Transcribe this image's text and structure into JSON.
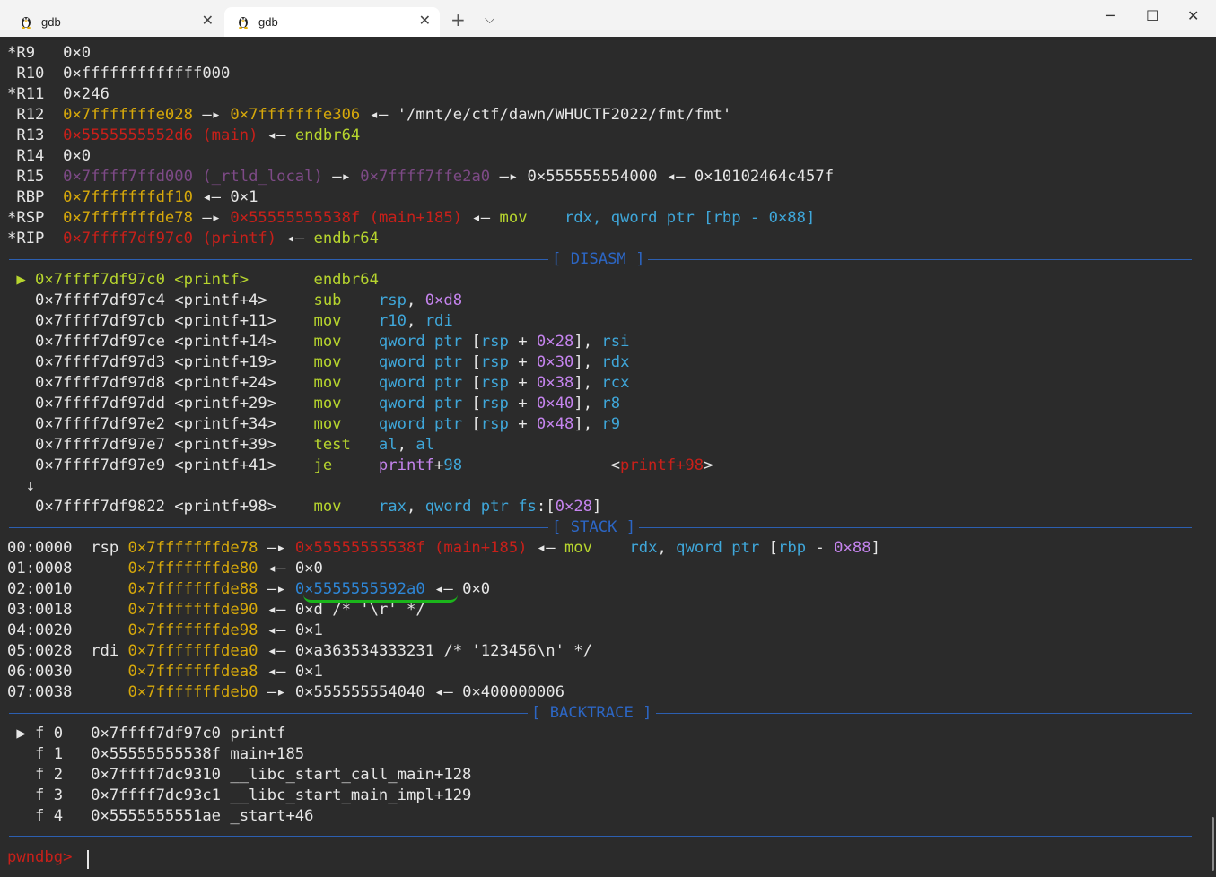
{
  "tabs": [
    {
      "label": "gdb"
    },
    {
      "label": "gdb"
    }
  ],
  "window": {
    "new_tab": "+",
    "dropdown": "⌵",
    "minimize": "─",
    "maximize": "☐",
    "close": "✕",
    "tab_close": "✕"
  },
  "registers": {
    "r9": {
      "name": "*R9",
      "val": "0×0"
    },
    "r10": {
      "name": " R10",
      "val": "0×fffffffffffff000"
    },
    "r11": {
      "name": "*R11",
      "val": "0×246"
    },
    "r12": {
      "name": " R12",
      "a1": "0×7fffffffe028",
      "arr1": " —▸ ",
      "a2": "0×7fffffffe306",
      "arr2": " ◂— ",
      "s": "'/mnt/e/ctf/dawn/WHUCTF2022/fmt/fmt'"
    },
    "r13": {
      "name": " R13",
      "a1": "0×5555555552d6 (main)",
      "arr1": " ◂— ",
      "s": "endbr64"
    },
    "r14": {
      "name": " R14",
      "val": "0×0"
    },
    "r15": {
      "name": " R15",
      "a1": "0×7ffff7ffd000 (_rtld_local)",
      "arr1": " —▸ ",
      "a2": "0×7ffff7ffe2a0",
      "arr2": " —▸ ",
      "a3": "0×555555554000",
      "arr3": " ◂— ",
      "a4": "0×10102464c457f"
    },
    "rbp": {
      "name": " RBP",
      "a1": "0×7fffffffdf10",
      "arr1": " ◂— ",
      "a2": "0×1"
    },
    "rsp": {
      "name": "*RSP",
      "a1": "0×7fffffffde78",
      "arr1": " —▸ ",
      "a2": "0×55555555538f (main+185)",
      "arr2": " ◂— ",
      "op": "mov",
      "args": "rdx, qword ptr [rbp - 0×88]"
    },
    "rip": {
      "name": "*RIP",
      "a1": "0×7ffff7df97c0 (printf)",
      "arr1": " ◂— ",
      "s": "endbr64"
    }
  },
  "sections": {
    "disasm": "[ DISASM ]",
    "stack": "[ STACK ]",
    "backtrace": "[ BACKTRACE ]"
  },
  "disasm": [
    {
      "mark": "▶",
      "addr": "0×7ffff7df97c0",
      "sym": "<printf>",
      "op": "endbr64",
      "args": ""
    },
    {
      "mark": " ",
      "addr": "0×7ffff7df97c4",
      "sym": "<printf+4>",
      "op": "sub",
      "args": "rsp, 0×d8"
    },
    {
      "mark": " ",
      "addr": "0×7ffff7df97cb",
      "sym": "<printf+11>",
      "op": "mov",
      "args": "r10, rdi"
    },
    {
      "mark": " ",
      "addr": "0×7ffff7df97ce",
      "sym": "<printf+14>",
      "op": "mov",
      "args": "qword ptr [rsp + 0×28], rsi"
    },
    {
      "mark": " ",
      "addr": "0×7ffff7df97d3",
      "sym": "<printf+19>",
      "op": "mov",
      "args": "qword ptr [rsp + 0×30], rdx"
    },
    {
      "mark": " ",
      "addr": "0×7ffff7df97d8",
      "sym": "<printf+24>",
      "op": "mov",
      "args": "qword ptr [rsp + 0×38], rcx"
    },
    {
      "mark": " ",
      "addr": "0×7ffff7df97dd",
      "sym": "<printf+29>",
      "op": "mov",
      "args": "qword ptr [rsp + 0×40], r8"
    },
    {
      "mark": " ",
      "addr": "0×7ffff7df97e2",
      "sym": "<printf+34>",
      "op": "mov",
      "args": "qword ptr [rsp + 0×48], r9"
    },
    {
      "mark": " ",
      "addr": "0×7ffff7df97e7",
      "sym": "<printf+39>",
      "op": "test",
      "args": "al, al"
    },
    {
      "mark": " ",
      "addr": "0×7ffff7df97e9",
      "sym": "<printf+41>",
      "op": "je",
      "args": "printf+98",
      "target": "<printf+98>"
    },
    {
      "mark": "↓",
      "addr": "",
      "sym": "",
      "op": "",
      "args": ""
    },
    {
      "mark": " ",
      "addr": "0×7ffff7df9822",
      "sym": "<printf+98>",
      "op": "mov",
      "args": "rax, qword ptr fs:[0×28]"
    }
  ],
  "stack": [
    {
      "off": "00:0000",
      "reg": "rsp",
      "addr": "0×7fffffffde78",
      "arr1": "—▸",
      "val": "0×55555555538f (main+185)",
      "arr2": "◂—",
      "extra": "mov    rdx, qword ptr [rbp - 0×88]"
    },
    {
      "off": "01:0008",
      "reg": "",
      "addr": "0×7fffffffde80",
      "arr1": "◂—",
      "val": "0×0",
      "arr2": "",
      "extra": ""
    },
    {
      "off": "02:0010",
      "reg": "",
      "addr": "0×7fffffffde88",
      "arr1": "—▸",
      "val": "0×5555555592a0",
      "arr2": "◂—",
      "extra": "0×0"
    },
    {
      "off": "03:0018",
      "reg": "",
      "addr": "0×7fffffffde90",
      "arr1": "◂—",
      "val": "0×d /* '\\r' */",
      "arr2": "",
      "extra": ""
    },
    {
      "off": "04:0020",
      "reg": "",
      "addr": "0×7fffffffde98",
      "arr1": "◂—",
      "val": "0×1",
      "arr2": "",
      "extra": ""
    },
    {
      "off": "05:0028",
      "reg": "rdi",
      "addr": "0×7fffffffdea0",
      "arr1": "◂—",
      "val": "0×a363534333231 /* '123456\\n' */",
      "arr2": "",
      "extra": ""
    },
    {
      "off": "06:0030",
      "reg": "",
      "addr": "0×7fffffffdea8",
      "arr1": "◂—",
      "val": "0×1",
      "arr2": "",
      "extra": ""
    },
    {
      "off": "07:0038",
      "reg": "",
      "addr": "0×7fffffffdeb0",
      "arr1": "—▸",
      "val": "0×555555554040",
      "arr2": "◂—",
      "extra": "0×400000006"
    }
  ],
  "backtrace": [
    {
      "mark": "▶",
      "frame": "f 0",
      "addr": "0×7ffff7df97c0",
      "sym": "printf"
    },
    {
      "mark": " ",
      "frame": "f 1",
      "addr": "0×55555555538f",
      "sym": "main+185"
    },
    {
      "mark": " ",
      "frame": "f 2",
      "addr": "0×7ffff7dc9310",
      "sym": "__libc_start_call_main+128"
    },
    {
      "mark": " ",
      "frame": "f 3",
      "addr": "0×7ffff7dc93c1",
      "sym": "__libc_start_main_impl+129"
    },
    {
      "mark": " ",
      "frame": "f 4",
      "addr": "0×5555555551ae",
      "sym": "_start+46"
    }
  ],
  "prompt": "pwndbg> ",
  "colors": {
    "background": "#2b2b2b",
    "address_yellow": "#d6a80b",
    "code_red": "#c8201a",
    "data_purple": "#7d4a86",
    "current_green": "#b7d52e",
    "register_blue": "#3fa7da",
    "number_magenta": "#c584ee",
    "separator_blue": "#2c5fb1",
    "underline_green": "#1bb51b"
  }
}
